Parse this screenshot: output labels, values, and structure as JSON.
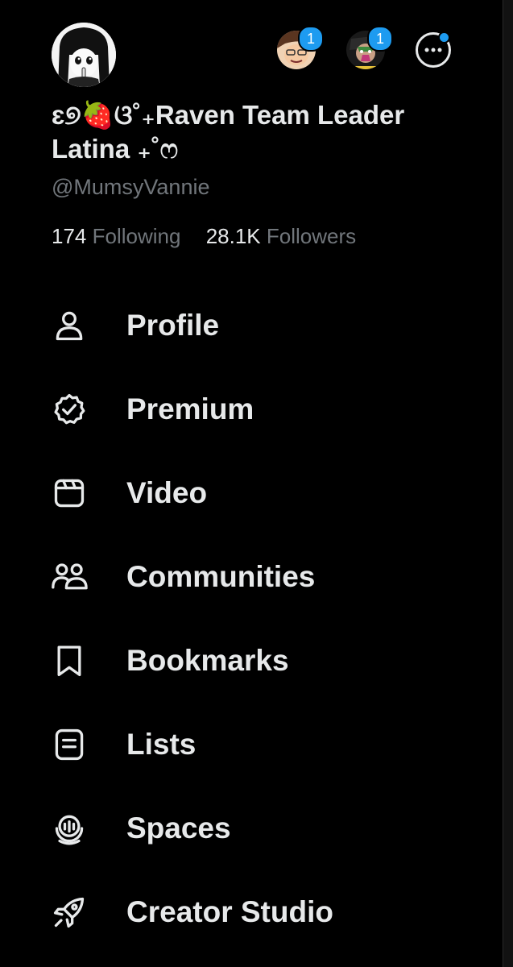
{
  "profile": {
    "display_name_line1": "ɛ୭🍓ଓ˚₊Raven Team Leader",
    "display_name_line2": "Latina ₊˚ෆ",
    "handle": "@MumsyVannie",
    "following_count": "174",
    "following_label": "Following",
    "followers_count": "28.1K",
    "followers_label": "Followers"
  },
  "accounts": [
    {
      "badge": "1"
    },
    {
      "badge": "1"
    }
  ],
  "colors": {
    "background": "#000000",
    "text_primary": "#e7e9ea",
    "text_secondary": "#71767b",
    "accent": "#1d9bf0"
  },
  "menu": [
    {
      "label": "Profile",
      "icon": "person-icon"
    },
    {
      "label": "Premium",
      "icon": "verified-badge-icon"
    },
    {
      "label": "Video",
      "icon": "video-icon"
    },
    {
      "label": "Communities",
      "icon": "communities-icon"
    },
    {
      "label": "Bookmarks",
      "icon": "bookmark-icon"
    },
    {
      "label": "Lists",
      "icon": "lists-icon"
    },
    {
      "label": "Spaces",
      "icon": "spaces-icon"
    },
    {
      "label": "Creator Studio",
      "icon": "rocket-icon"
    }
  ]
}
